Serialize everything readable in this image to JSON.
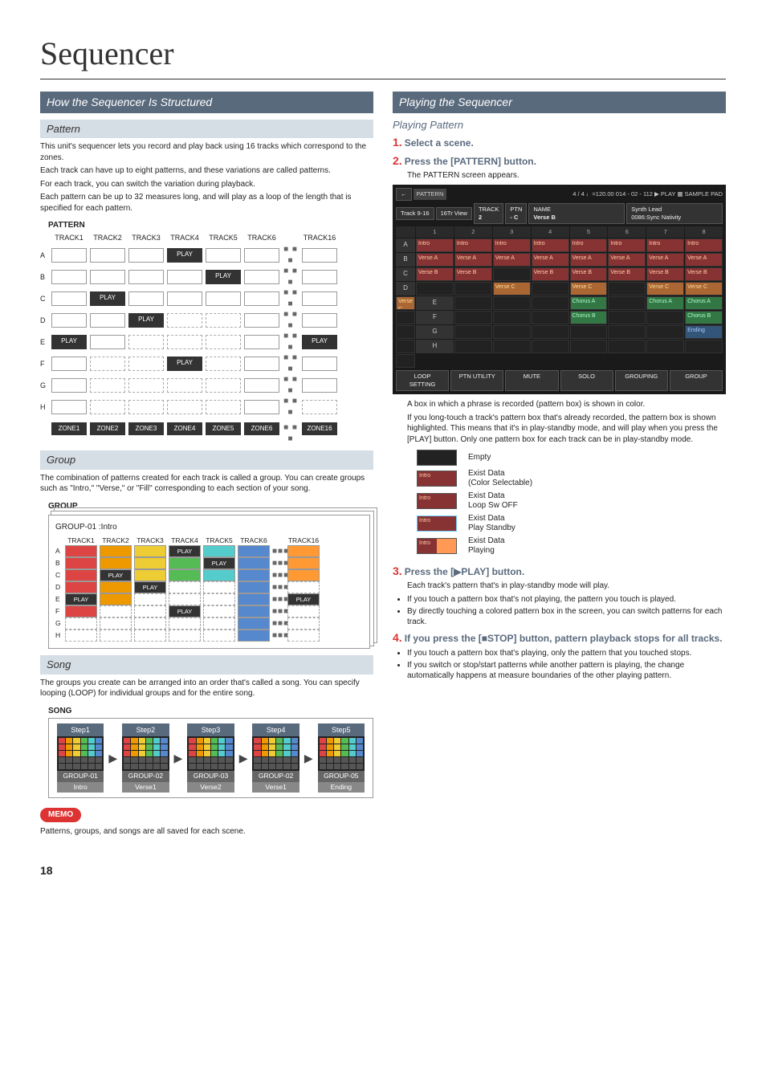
{
  "page_title": "Sequencer",
  "page_number": "18",
  "left": {
    "section": "How the Sequencer Is Structured",
    "pattern": {
      "heading": "Pattern",
      "p1": "This unit's sequencer lets you record and play back using 16 tracks which correspond to the zones.",
      "p2": "Each track can have up to eight patterns, and these variations are called patterns.",
      "p3": "For each track, you can switch the variation during playback.",
      "p4": "Each pattern can be up to 32 measures long, and will play as a loop of the length that is specified for each pattern.",
      "fig_label": "PATTERN",
      "tracks": [
        "TRACK1",
        "TRACK2",
        "TRACK3",
        "TRACK4",
        "TRACK5",
        "TRACK6",
        "TRACK16"
      ],
      "rows": [
        "A",
        "B",
        "C",
        "D",
        "E",
        "F",
        "G",
        "H"
      ],
      "zones": [
        "ZONE1",
        "ZONE2",
        "ZONE3",
        "ZONE4",
        "ZONE5",
        "ZONE6",
        "ZONE16"
      ],
      "play_label": "PLAY"
    },
    "group": {
      "heading": "Group",
      "p1": "The combination of patterns created for each track is called a group. You can create groups such as \"Intro,\" \"Verse,\" or \"Fill\" corresponding to each section of your song.",
      "fig_label": "GROUP",
      "group_title": "GROUP-01 :Intro",
      "tracks": [
        "TRACK1",
        "TRACK2",
        "TRACK3",
        "TRACK4",
        "TRACK5",
        "TRACK6",
        "TRACK16"
      ],
      "rows": [
        "A",
        "B",
        "C",
        "D",
        "E",
        "F",
        "G",
        "H"
      ]
    },
    "song": {
      "heading": "Song",
      "p1": "The groups you create can be arranged into an order that's called a song. You can specify looping (LOOP) for individual groups and for the entire song.",
      "fig_label": "SONG",
      "steps": [
        {
          "step": "Step1",
          "group": "GROUP-01",
          "name": "Intro"
        },
        {
          "step": "Step2",
          "group": "GROUP-02",
          "name": "Verse1"
        },
        {
          "step": "Step3",
          "group": "GROUP-03",
          "name": "Verse2"
        },
        {
          "step": "Step4",
          "group": "GROUP-02",
          "name": "Verse1"
        },
        {
          "step": "Step5",
          "group": "GROUP-05",
          "name": "Ending"
        }
      ]
    },
    "memo": {
      "label": "MEMO",
      "text": "Patterns, groups, and songs are all saved for each scene."
    }
  },
  "right": {
    "section": "Playing the Sequencer",
    "sub": "Playing Pattern",
    "step1": {
      "num": "1.",
      "text": "Select a scene."
    },
    "step2": {
      "num": "2.",
      "text": "Press the [PATTERN] button.",
      "sub": "The PATTERN screen appears."
    },
    "screenshot": {
      "top_tabs": [
        "PATTERN"
      ],
      "top_right": "4 / 4  ♩=120.00  014 - 02 - 112   ▶ PLAY   ▦ SAMPLE PAD",
      "track_btn_a": "Track 9-16",
      "track_btn_b": "16Tr View",
      "track_label": "TRACK",
      "track_val": "2",
      "ptn_label": "PTN",
      "ptn_val": "- C",
      "name_label": "NAME",
      "name_val": "Verse B",
      "tone_top": "Synth Lead",
      "tone_bottom": "0086:Sync Nativity",
      "cols": [
        "1",
        "2",
        "3",
        "4",
        "5",
        "6",
        "7",
        "8"
      ],
      "rows": [
        "A",
        "B",
        "C",
        "D",
        "E",
        "F",
        "G",
        "H"
      ],
      "cells": {
        "A": [
          "Intro",
          "Intro",
          "Intro",
          "Intro",
          "Intro",
          "Intro",
          "Intro",
          "Intro"
        ],
        "B": [
          "Verse A",
          "Verse A",
          "Verse A",
          "Verse A",
          "Verse A",
          "Verse A",
          "Verse A",
          "Verse A"
        ],
        "C": [
          "Verse B",
          "Verse B",
          "",
          "Verse B",
          "Verse B",
          "Verse B",
          "Verse B",
          "Verse B"
        ],
        "D": [
          "",
          "",
          "Verse C",
          "",
          "Verse C",
          "",
          "Verse C",
          "Verse C",
          "Verse C"
        ],
        "E": [
          "",
          "",
          "",
          "Chorus A",
          "",
          "Chorus A",
          "Chorus A",
          ""
        ],
        "F": [
          "",
          "",
          "",
          "Chorus B",
          "",
          "",
          "Chorus B",
          ""
        ],
        "G": [
          "",
          "",
          "",
          "",
          "",
          "",
          "Ending",
          ""
        ],
        "H": [
          "",
          "",
          "",
          "",
          "",
          "",
          "",
          ""
        ]
      },
      "bottom": [
        "LOOP SETTING",
        "PTN UTILITY",
        "MUTE",
        "SOLO",
        "GROUPING",
        "GROUP"
      ]
    },
    "after_scr_p1": "A box in which a phrase is recorded (pattern box) is shown in color.",
    "after_scr_p2": "If you long-touch a track's pattern box that's already recorded, the pattern box is shown highlighted. This means that it's in play-standby mode, and will play when you press the [PLAY] button. Only one pattern box for each track can be in play-standby mode.",
    "legend": [
      {
        "label": "Intro",
        "cls": "empty",
        "text": "Empty"
      },
      {
        "label": "Intro",
        "cls": "sel",
        "text": "Exist Data\n(Color Selectable)"
      },
      {
        "label": "Intro",
        "cls": "loop",
        "text": "Exist Data\nLoop Sw OFF"
      },
      {
        "label": "Intro",
        "cls": "standby",
        "text": "Exist Data\nPlay Standby"
      },
      {
        "label": "Intro",
        "cls": "playing",
        "text": "Exist Data\nPlaying"
      }
    ],
    "step3": {
      "num": "3.",
      "text_pre": "Press the [",
      "text_icon": "▶",
      "text_post": "PLAY] button.",
      "sub": "Each track's pattern that's in play-standby mode will play.",
      "bullets": [
        "If you touch a pattern box that's not playing, the pattern you touch is played.",
        "By directly touching a colored pattern box in the screen, you can switch patterns for each track."
      ]
    },
    "step4": {
      "num": "4.",
      "text_pre": "If you press the [",
      "text_icon": "■",
      "text_post": "STOP] button, pattern playback stops for all tracks.",
      "bullets": [
        "If you touch a pattern box that's playing, only the pattern that you touched stops.",
        "If you switch or stop/start patterns while another pattern is playing, the change automatically happens at measure boundaries of the other playing pattern."
      ]
    }
  }
}
